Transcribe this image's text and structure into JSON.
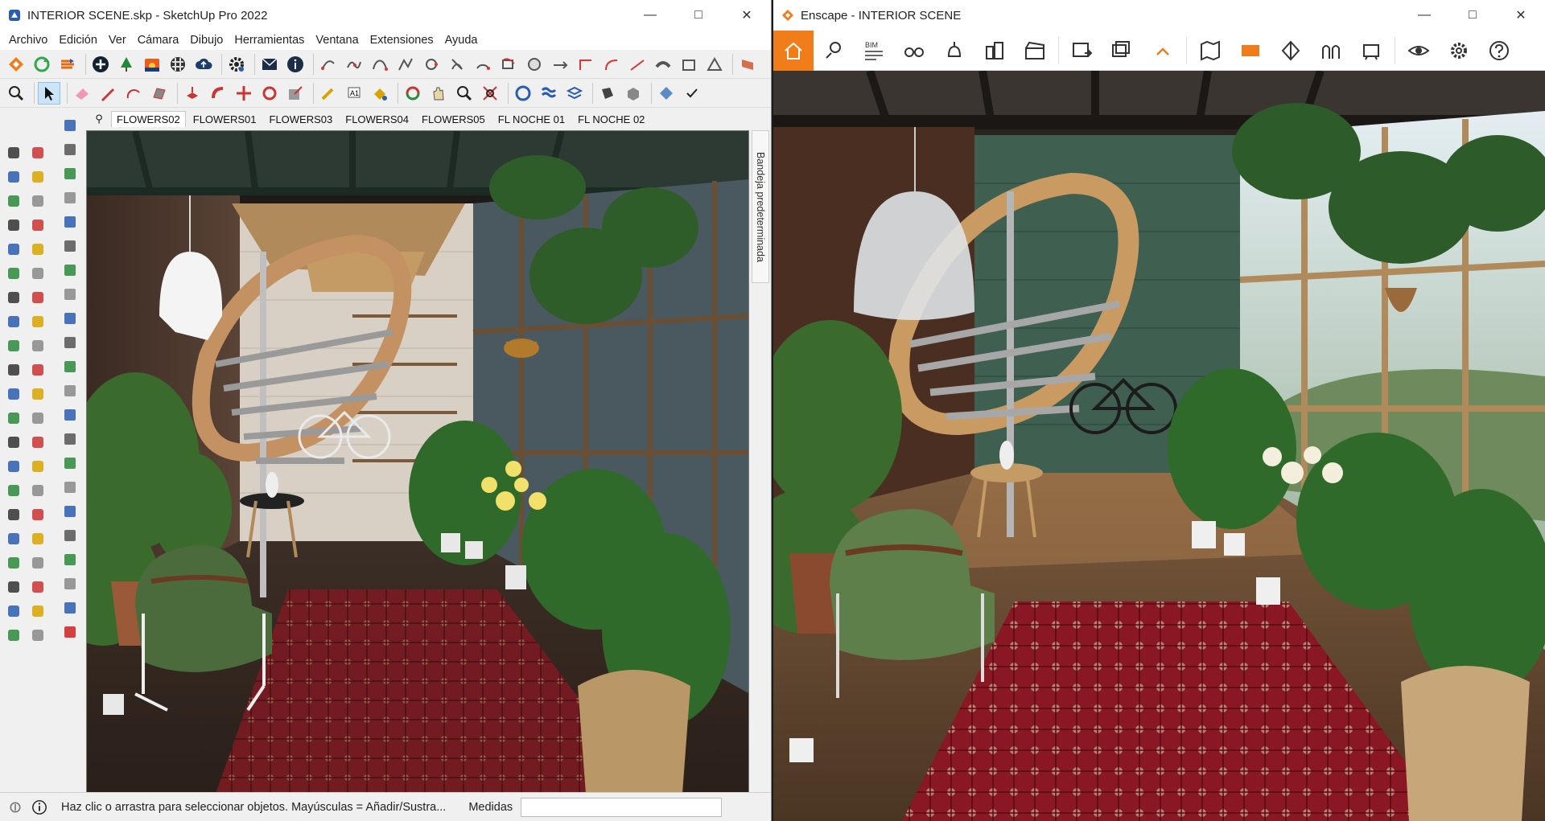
{
  "sketchup": {
    "title": "INTERIOR SCENE.skp - SketchUp Pro 2022",
    "menu": [
      "Archivo",
      "Edición",
      "Ver",
      "Cámara",
      "Dibujo",
      "Herramientas",
      "Ventana",
      "Extensiones",
      "Ayuda"
    ],
    "scene_tabs": [
      "FLOWERS02",
      "FLOWERS01",
      "FLOWERS03",
      "FLOWERS04",
      "FLOWERS05",
      "FL NOCHE 01",
      "FL NOCHE 02"
    ],
    "active_scene": "FLOWERS02",
    "tray_label": "Bandeja predeterminada",
    "status_message": "Haz clic o arrastra para seleccionar objetos. Mayúsculas = Añadir/Sustra...",
    "measurements_label": "Medidas",
    "measurements_value": ""
  },
  "enscape": {
    "title": "Enscape - INTERIOR SCENE",
    "bim_label": "BIM"
  },
  "colors": {
    "enscape_accent": "#f07d1a",
    "sketchup_blue": "#2a5db0"
  }
}
